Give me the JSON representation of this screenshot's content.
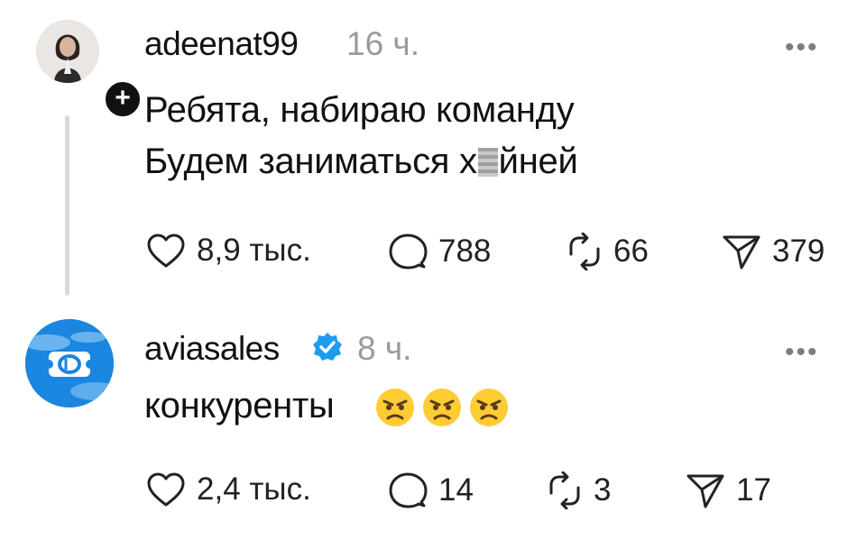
{
  "posts": [
    {
      "username": "adeenat99",
      "time": "16 ч.",
      "more": "•••",
      "lines": [
        "Ребята, набираю команду",
        "Будем заниматься х",
        "йней"
      ],
      "likes": "8,9 тыс.",
      "comments": "788",
      "reposts": "66",
      "shares": "379"
    },
    {
      "username": "aviasales",
      "time": "8 ч.",
      "more": "•••",
      "lines": [
        "конкуренты"
      ],
      "emojis": [
        "angry-face",
        "angry-face",
        "angry-face"
      ],
      "likes": "2,4 тыс.",
      "comments": "14",
      "reposts": "3",
      "shares": "17"
    }
  ],
  "icons": {
    "like": "heart-icon",
    "comment": "comment-bubble-icon",
    "repost": "repost-icon",
    "share": "send-icon",
    "follow": "plus-icon",
    "verified": "verified-badge-icon"
  },
  "colors": {
    "verified": "#1d9bf0",
    "avatar_bg": "#1a86e0",
    "muted": "#9a9a9a"
  }
}
